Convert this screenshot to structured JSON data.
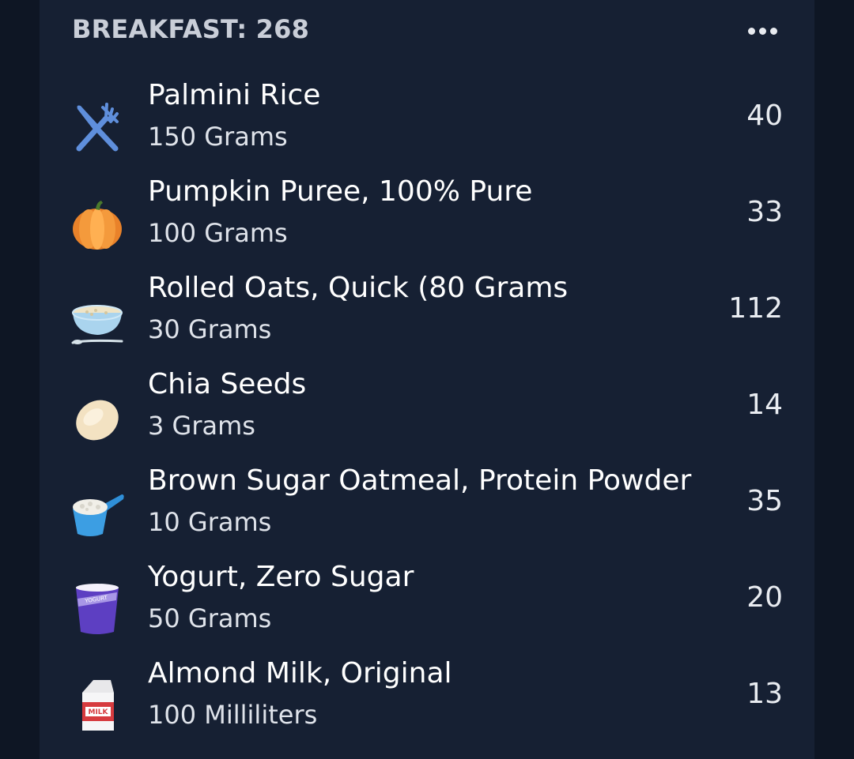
{
  "meal": {
    "title": "BREAKFAST: 268",
    "more_icon": "more-horizontal-icon"
  },
  "items": [
    {
      "name": "Palmini Rice",
      "quantity": "150 Grams",
      "calories": "40",
      "icon": "fork-knife-icon"
    },
    {
      "name": "Pumpkin Puree, 100% Pure",
      "quantity": "100 Grams",
      "calories": "33",
      "icon": "pumpkin-icon"
    },
    {
      "name": "Rolled Oats, Quick (80 Grams",
      "quantity": "30 Grams",
      "calories": "112",
      "icon": "cereal-bowl-icon"
    },
    {
      "name": "Chia Seeds",
      "quantity": "3 Grams",
      "calories": "14",
      "icon": "seed-icon"
    },
    {
      "name": "Brown Sugar Oatmeal, Protein Powder",
      "quantity": "10 Grams",
      "calories": "35",
      "icon": "measuring-scoop-icon"
    },
    {
      "name": "Yogurt, Zero Sugar",
      "quantity": "50 Grams",
      "calories": "20",
      "icon": "yogurt-cup-icon"
    },
    {
      "name": "Almond Milk, Original",
      "quantity": "100 Milliliters",
      "calories": "13",
      "icon": "milk-carton-icon"
    }
  ],
  "icon_labels": {
    "yogurt": "YOGURT",
    "milk": "MILK"
  },
  "colors": {
    "background": "#111a2a",
    "card": "#162033",
    "text": "#ffffff"
  }
}
